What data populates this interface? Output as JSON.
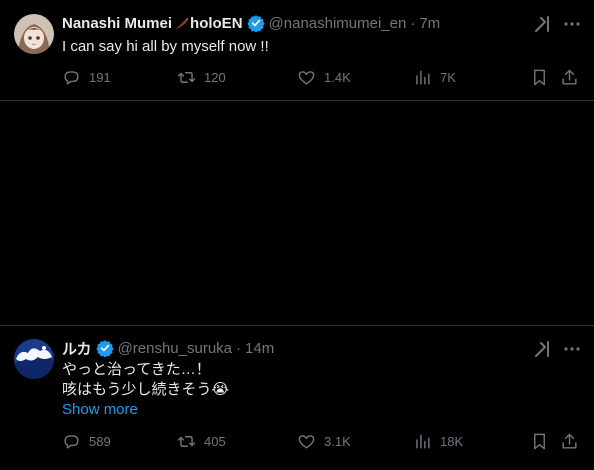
{
  "tweets": [
    {
      "author_name": "Nanashi Mumei",
      "author_suffix": "holoEN",
      "handle": "@nanashimumei_en",
      "separator": "·",
      "time": "7m",
      "text": "I can say hi all by myself now !!",
      "replies": "191",
      "reposts": "120",
      "likes": "1.4K",
      "views": "7K",
      "accent_color": "#1d9bf0"
    },
    {
      "author_name": "ルカ",
      "handle": "@renshu_suruka",
      "separator": "·",
      "time": "14m",
      "text_line1": "やっと治ってきた…！",
      "text_line2": "咳はもう少し続きそう😭",
      "show_more": "Show more",
      "replies": "589",
      "reposts": "405",
      "likes": "3.1K",
      "views": "18K"
    }
  ],
  "icons": {
    "reply": "reply-icon",
    "repost": "repost-icon",
    "like": "heart-icon",
    "views": "views-icon",
    "bookmark": "bookmark-icon",
    "share": "share-icon",
    "grok": "grok-icon",
    "more": "more-icon",
    "verified": "verified-badge-icon",
    "feather": "feather-icon"
  },
  "colors": {
    "background": "#000000",
    "text": "#e7e9ea",
    "muted": "#71767b",
    "link": "#1d9bf0",
    "divider": "#2f3336"
  }
}
